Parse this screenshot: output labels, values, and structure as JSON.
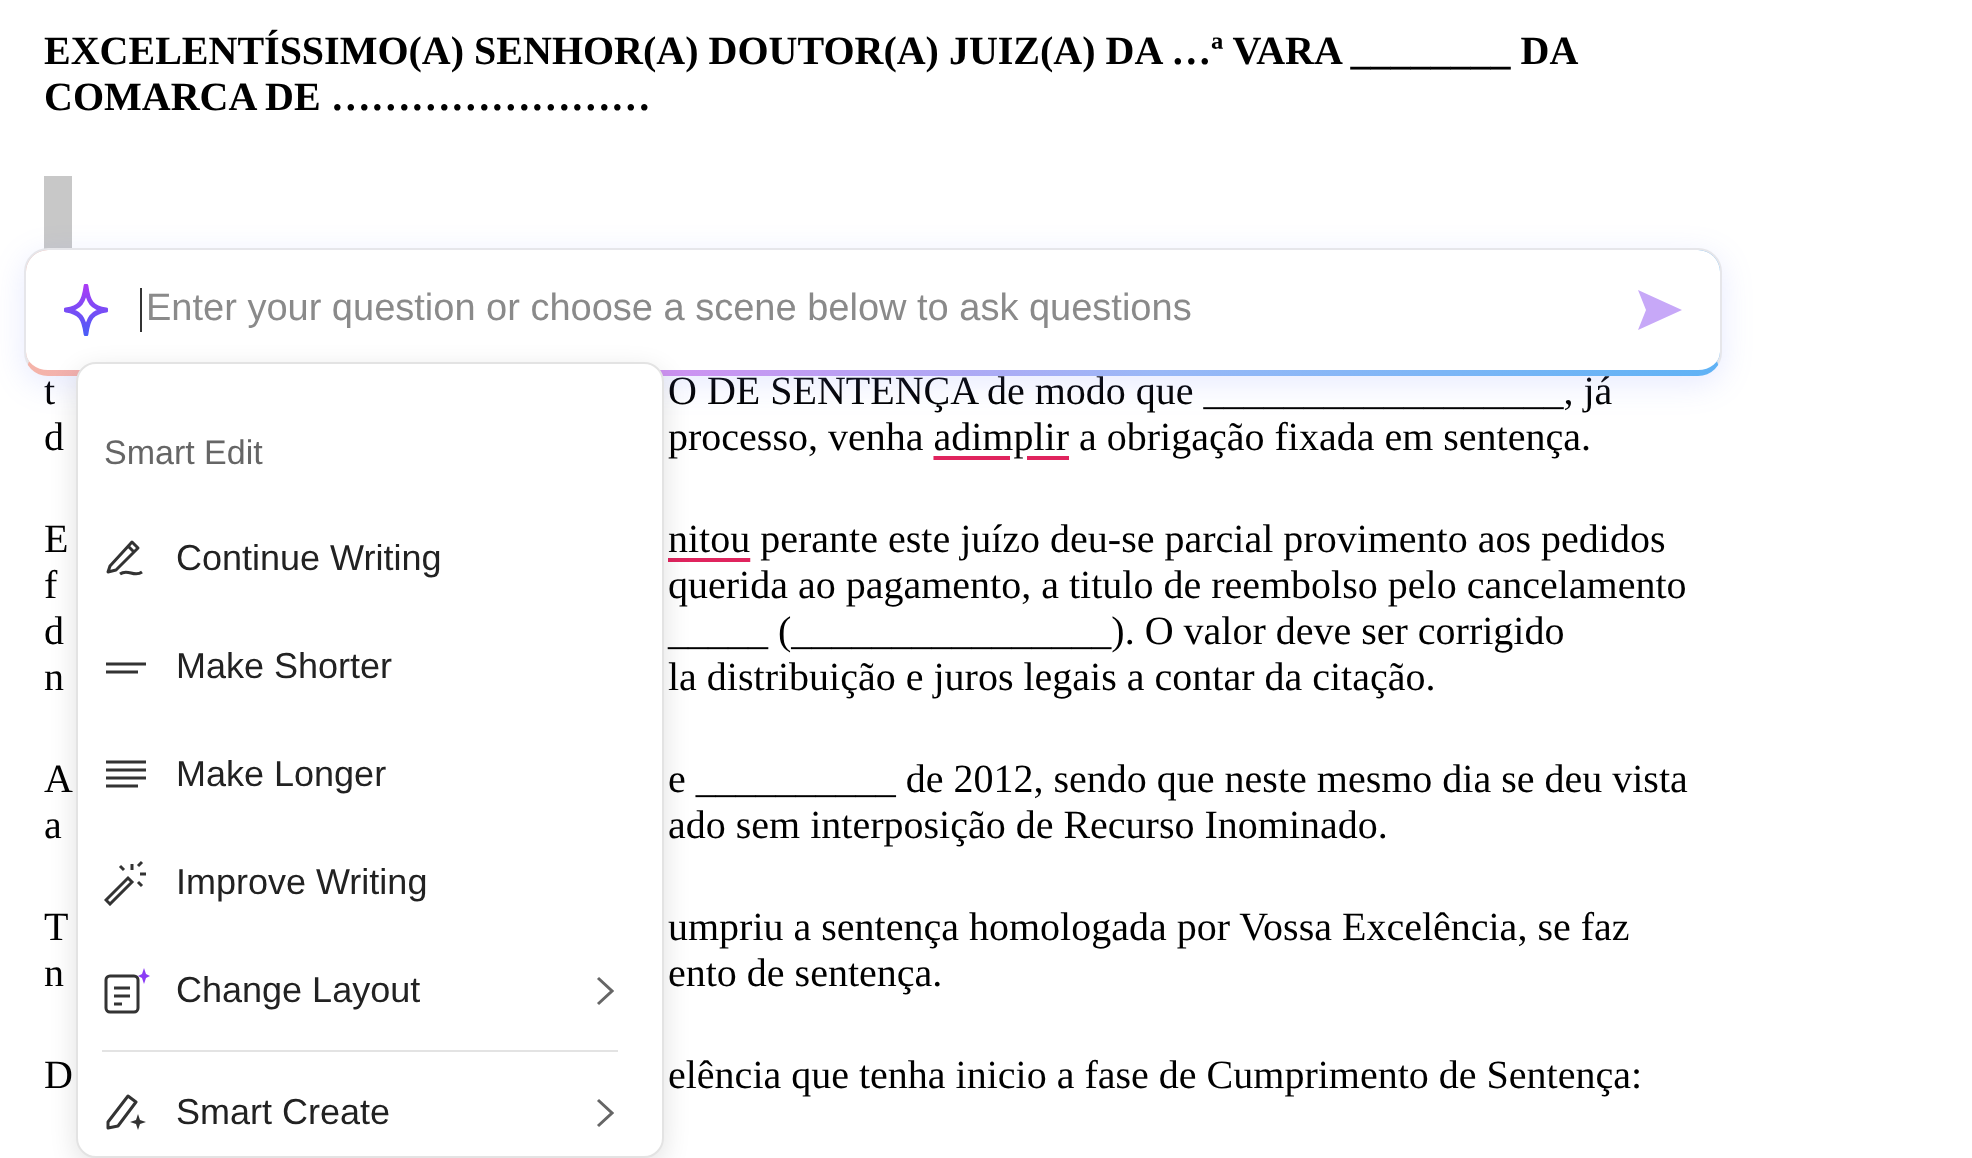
{
  "document": {
    "heading": "EXCELENTÍSSIMO(A) SENHOR(A) DOUTOR(A) JUIZ(A) DA …ª VARA ________ DA COMARCA DE ……………………",
    "paragraphs": [
      {
        "lines": [
          {
            "left": "t",
            "right": [
              {
                "text": "O DE SENTENÇA de modo que __________________, já",
                "misspelled": false
              }
            ]
          },
          {
            "left": "d",
            "right": [
              {
                "text": "processo, venha ",
                "misspelled": false
              },
              {
                "text": "adimplir",
                "misspelled": true
              },
              {
                "text": " a obrigação fixada em sentença.",
                "misspelled": false
              }
            ]
          }
        ]
      },
      {
        "lines": [
          {
            "left": "E",
            "right": [
              {
                "text": "nitou",
                "misspelled": true
              },
              {
                "text": " perante este juízo deu-se parcial provimento aos pedidos",
                "misspelled": false
              }
            ]
          },
          {
            "left": "f",
            "right": [
              {
                "text": "querida ao pagamento, a titulo de reembolso pelo cancelamento",
                "misspelled": false
              }
            ]
          },
          {
            "left": "d",
            "right": [
              {
                "text": "_____ (________________). O valor deve ser corrigido",
                "misspelled": false
              }
            ]
          },
          {
            "left": "n",
            "right": [
              {
                "text": "la distribuição e juros legais a contar da citação.",
                "misspelled": false
              }
            ]
          }
        ]
      },
      {
        "lines": [
          {
            "left": "A",
            "right": [
              {
                "text": "e __________ de 2012, sendo que neste mesmo dia se deu vista",
                "misspelled": false
              }
            ]
          },
          {
            "left": "a",
            "right": [
              {
                "text": "ado sem interposição de Recurso Inominado.",
                "misspelled": false
              }
            ]
          }
        ]
      },
      {
        "lines": [
          {
            "left": "T",
            "right": [
              {
                "text": "umpriu a sentença homologada por Vossa Excelência, se faz",
                "misspelled": false
              }
            ]
          },
          {
            "left": "n",
            "right": [
              {
                "text": "ento de sentença.",
                "misspelled": false
              }
            ]
          }
        ]
      },
      {
        "lines": [
          {
            "left": "D",
            "right": [
              {
                "text": "elência que tenha inicio a fase de Cumprimento de Sentença:",
                "misspelled": false
              }
            ]
          }
        ]
      }
    ]
  },
  "ask_box": {
    "placeholder": "Enter your question or choose a scene below to ask questions"
  },
  "menu": {
    "header": "Smart Edit",
    "items": [
      {
        "label": "Continue Writing",
        "kind": "pen",
        "has_submenu": false,
        "divider_before": false
      },
      {
        "label": "Make Shorter",
        "kind": "short",
        "has_submenu": false,
        "divider_before": false
      },
      {
        "label": "Make Longer",
        "kind": "long",
        "has_submenu": false,
        "divider_before": false
      },
      {
        "label": "Improve Writing",
        "kind": "wand",
        "has_submenu": false,
        "divider_before": false
      },
      {
        "label": "Change Layout",
        "kind": "layout",
        "has_submenu": true,
        "divider_before": false
      },
      {
        "label": "Smart Create",
        "kind": "create",
        "has_submenu": true,
        "divider_before": true
      }
    ]
  }
}
